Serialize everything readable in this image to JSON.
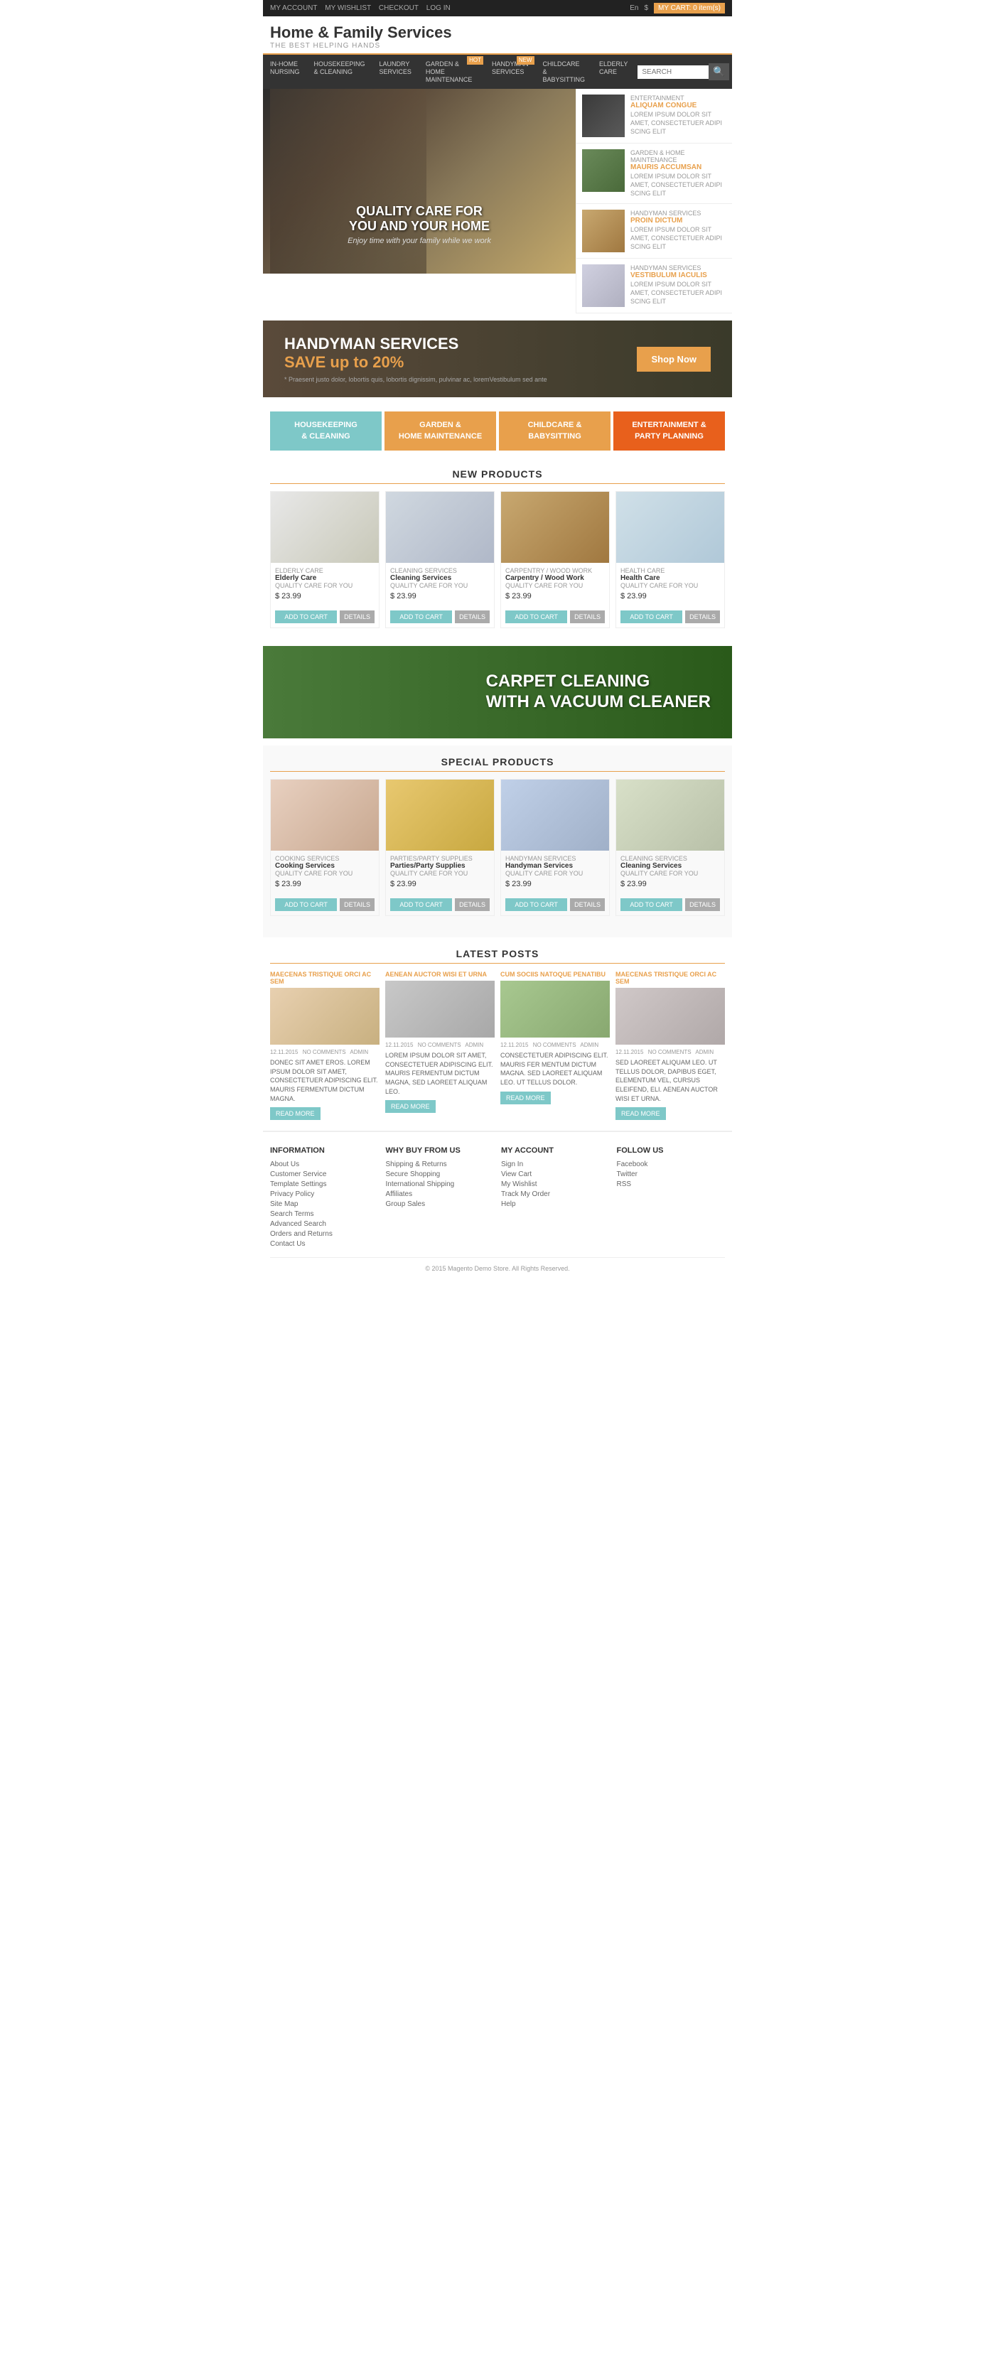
{
  "topbar": {
    "links": [
      "MY ACCOUNT",
      "MY WISHLIST",
      "CHECKOUT",
      "LOG IN"
    ],
    "lang": "En",
    "currency": "$",
    "cart_label": "MY CART:",
    "cart_items": "0 item(s)"
  },
  "header": {
    "title": "Home & Family Services",
    "tagline": "THE BEST HELPING HANDS"
  },
  "nav": {
    "items": [
      {
        "label": "IN-HOME\nNURSING"
      },
      {
        "label": "HOUSEKEEPING\n& CLEANING"
      },
      {
        "label": "LAUNDRY\nSERVICES"
      },
      {
        "label": "GARDEN &\nHOME MAINTENANCE",
        "badge": "HOT"
      },
      {
        "label": "HANDYMAN\nSERVICES",
        "badge": "NEW"
      },
      {
        "label": "CHILDCARE &\nBABYSITTING"
      },
      {
        "label": "ELDERLY\nCARE"
      }
    ],
    "search_placeholder": "SEARCH"
  },
  "hero": {
    "heading": "QUALITY CARE FOR YOU AND YOUR HOME",
    "subheading": "Enjoy time with your family while we work"
  },
  "sidebar_posts": [
    {
      "category": "ENTERTAINMENT",
      "title": "ALIQUAM CONGUE",
      "desc": "LOREM IPSUM DOLOR SIT AMET, CONSECTETUER ADIPI SCING ELIT"
    },
    {
      "category": "GARDEN & HOME MAINTENANCE",
      "title": "MAURIS ACCUMSAN",
      "desc": "LOREM IPSUM DOLOR SIT AMET, CONSECTETUER ADIPI SCING ELIT"
    },
    {
      "category": "HANDYMAN SERVICES",
      "title": "PROIN DICTUM",
      "desc": "LOREM IPSUM DOLOR SIT AMET, CONSECTETUER ADIPI SCING ELIT"
    },
    {
      "category": "HANDYMAN SERVICES",
      "title": "VESTIBULUM IACULIS",
      "desc": "LOREM IPSUM DOLOR SIT AMET, CONSECTETUER ADIPI SCING ELIT"
    }
  ],
  "banner": {
    "line1": "HANDYMAN SERVICES",
    "line2": "SAVE up to 20%",
    "footnote": "* Praesent justo dolor, lobortis quis, lobortis dignissim, pulvinar ac, loremVestibulum sed ante",
    "button": "Shop Now"
  },
  "categories": [
    {
      "label": "HOUSEKEEPING\n& CLEANING",
      "color": "cat-box-blue"
    },
    {
      "label": "GARDEN &\nHOME MAINTENANCE",
      "color": "cat-box-orange"
    },
    {
      "label": "CHILDCARE &\nBABYSITTING",
      "color": "cat-box-pink"
    },
    {
      "label": "ENTERTAINMENT &\nPARTY PLANNING",
      "color": "cat-box-dark"
    }
  ],
  "new_products": {
    "title": "NEW PRODUCTS",
    "items": [
      {
        "category": "ELDERLY CARE",
        "name": "Elderly Care",
        "desc": "QUALITY CARE FOR YOU",
        "price": "$ 23.99",
        "img_class": "img-elderly"
      },
      {
        "category": "CLEANING SERVICES",
        "name": "Cleaning Services",
        "desc": "QUALITY CARE FOR YOU",
        "price": "$ 23.99",
        "img_class": "img-cleaning"
      },
      {
        "category": "CARPENTRY / WOOD WORK",
        "name": "Carpentry / Wood Work",
        "desc": "QUALITY CARE FOR YOU",
        "price": "$ 23.99",
        "img_class": "img-carpentry"
      },
      {
        "category": "HEALTH CARE",
        "name": "Health Care",
        "desc": "QUALITY CARE FOR YOU",
        "price": "$ 23.99",
        "img_class": "img-health"
      }
    ],
    "btn_cart": "ADD TO CART",
    "btn_details": "DETAILS"
  },
  "carpet_banner": {
    "line1": "CARPET CLEANING",
    "line2": "WITH A VACUUM CLEANER"
  },
  "special_products": {
    "title": "SPECIAL PRODUCTS",
    "items": [
      {
        "category": "COOKING SERVICES",
        "name": "Cooking Services",
        "desc": "QUALITY CARE FOR YOU",
        "price": "$ 23.99",
        "img_class": "img-cooking"
      },
      {
        "category": "PARTIES/PARTY SUPPLIES",
        "name": "Parties/Party Supplies",
        "desc": "QUALITY CARE FOR YOU",
        "price": "$ 23.99",
        "img_class": "img-party"
      },
      {
        "category": "HANDYMAN SERVICES",
        "name": "Handyman Services",
        "desc": "QUALITY CARE FOR YOU",
        "price": "$ 23.99",
        "img_class": "img-handyman"
      },
      {
        "category": "CLEANING SERVICES",
        "name": "Cleaning Services",
        "desc": "QUALITY CARE FOR YOU",
        "price": "$ 23.99",
        "img_class": "img-cleaning2"
      }
    ],
    "btn_cart": "ADD TO CART",
    "btn_details": "DETAILS"
  },
  "latest_posts": {
    "title": "LATEST POSTS",
    "items": [
      {
        "category": "MAECENAS TRISTIQUE ORCI AC SEM",
        "date": "12.11.2015",
        "comments": "NO COMMENTS",
        "author": "ADMIN",
        "text": "DONEC SIT AMET EROS. LOREM IPSUM DOLOR SIT AMET, CONSECTETUER ADIPISCING ELIT. MAURIS FERMENTUM DICTUM MAGNA.",
        "img_class": "img-post1",
        "btn": "READ MORE"
      },
      {
        "category": "AENEAN AUCTOR WISI ET URNA",
        "date": "12.11.2015",
        "comments": "NO COMMENTS",
        "author": "ADMIN",
        "text": "LOREM IPSUM DOLOR SIT AMET, CONSECTETUER ADIPISCING ELIT. MAURIS FERMENTUM DICTUM MAGNA, SED LAOREET ALIQUAM LEO.",
        "img_class": "img-post2",
        "btn": "READ MORE"
      },
      {
        "category": "CUM SOCIIS NATOQUE PENATIBU",
        "date": "12.11.2015",
        "comments": "NO COMMENTS",
        "author": "ADMIN",
        "text": "CONSECTETUER ADIPISCING ELIT. MAURIS FER MENTUM DICTUM MAGNA. SED LAOREET ALIQUAM LEO. UT TELLUS DOLOR.",
        "img_class": "img-post3",
        "btn": "READ MORE"
      },
      {
        "category": "MAECENAS TRISTIQUE ORCI AC SEM",
        "date": "12.11.2015",
        "comments": "NO COMMENTS",
        "author": "ADMIN",
        "text": "SED LAOREET ALIQUAM LEO. UT TELLUS DOLOR, DAPIBUS EGET, ELEMENTUM VEL, CURSUS ELEIFEND, ELI. AENEAN AUCTOR WISI ET URNA.",
        "img_class": "img-post4",
        "btn": "READ MORE"
      }
    ]
  },
  "footer": {
    "cols": [
      {
        "title": "INFORMATION",
        "links": [
          "About Us",
          "Customer Service",
          "Template Settings",
          "Privacy Policy",
          "Site Map",
          "Search Terms",
          "Advanced Search",
          "Orders and Returns",
          "Contact Us"
        ]
      },
      {
        "title": "WHY BUY FROM US",
        "links": [
          "Shipping & Returns",
          "Secure Shopping",
          "International Shipping",
          "Affiliates",
          "Group Sales"
        ]
      },
      {
        "title": "MY ACCOUNT",
        "links": [
          "Sign In",
          "View Cart",
          "My Wishlist",
          "Track My Order",
          "Help"
        ]
      },
      {
        "title": "FOLLOW US",
        "links": [
          "Facebook",
          "Twitter",
          "RSS"
        ]
      }
    ],
    "copyright": "© 2015 Magento Demo Store. All Rights Reserved."
  }
}
